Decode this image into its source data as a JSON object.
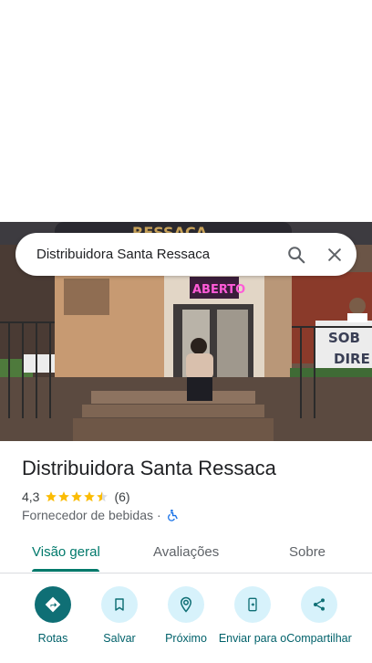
{
  "search": {
    "query": "Distribuidora Santa Ressaca"
  },
  "photo": {
    "sign_top": "RESSACA",
    "sign_neon": "ABERTO",
    "banner_line1": "SOB",
    "banner_line2": "DIRE"
  },
  "place": {
    "title": "Distribuidora Santa Ressaca",
    "rating": "4,3",
    "review_count": "(6)",
    "category": "Fornecedor de bebidas",
    "separator": "·",
    "stars": 4.3
  },
  "tabs": [
    {
      "label": "Visão geral",
      "active": true
    },
    {
      "label": "Avaliações",
      "active": false
    },
    {
      "label": "Sobre",
      "active": false
    }
  ],
  "actions": [
    {
      "label": "Rotas",
      "icon": "directions-icon"
    },
    {
      "label": "Salvar",
      "icon": "bookmark-icon"
    },
    {
      "label": "Próximo",
      "icon": "nearby-icon"
    },
    {
      "label": "Enviar para o",
      "icon": "send-to-phone-icon"
    },
    {
      "label": "Compartilhar",
      "icon": "share-icon"
    }
  ],
  "colors": {
    "accent": "#00796b",
    "action_bg": "#d7f2fb",
    "primary_action": "#0f6f75",
    "star": "#fbbc04"
  }
}
